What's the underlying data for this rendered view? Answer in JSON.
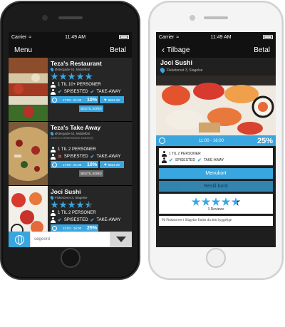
{
  "status": {
    "carrier": "Carrier",
    "time": "11:49 AM"
  },
  "left": {
    "nav": {
      "menu_label": "Menu",
      "pay_label": "Betal"
    },
    "restaurants": [
      {
        "name": "Teza's Restaurant",
        "address": "Østergade 62, Middelfart",
        "notice": "",
        "rating": 5,
        "persons": "1 TIL 10+ PERSONER",
        "dine_in_label": "SPISESTED",
        "dine_in": true,
        "takeaway_label": "TAKE-AWAY",
        "takeaway": true,
        "time": "17:00 - 21:30",
        "discount": "10%",
        "price": "6824.29",
        "book_label": "BESTIL BORD",
        "book_enabled": true
      },
      {
        "name": "Teza's Take Away",
        "address": "Østergade 62, Middelfart",
        "notice": "INGEN VORBEREDNE EMNE(R)",
        "rating": 0,
        "persons": "1 TIL 2 PERSONER",
        "dine_in_label": "SPISESTED",
        "dine_in": false,
        "takeaway_label": "TAKE-AWAY",
        "takeaway": true,
        "time": "17:00 - 21:30",
        "discount": "10%",
        "price": "6824.29",
        "book_label": "BESTIL BORD",
        "book_enabled": false
      },
      {
        "name": "Joci Sushi",
        "address": "Fisketorvet 3, Slagelse",
        "notice": "",
        "rating": 4.5,
        "persons": "1 TIL 2 PERSONER",
        "dine_in_label": "SPISESTED",
        "dine_in": true,
        "takeaway_label": "TAKE-AWAY",
        "takeaway": true,
        "time": "11:00 - 16:00",
        "discount": "25%",
        "price": "",
        "book_label": "",
        "book_enabled": true
      }
    ],
    "search": {
      "placeholder": "søgeord"
    }
  },
  "right": {
    "nav": {
      "back_label": "Tilbage",
      "pay_label": "Betal"
    },
    "name": "Joci Sushi",
    "address": "Fisketorvet 3, Slagelse",
    "time": "11:00 - 16:00",
    "discount": "25%",
    "persons": "1 TIL 2 PERSONER",
    "dine_in_label": "SPISESTED",
    "takeaway_label": "TAKE-AWAY",
    "menu_button": "Menukort",
    "book_button": "Bestil bord",
    "rating": 4.5,
    "reviews": "3 Reviews",
    "description": "På Fisketorvet i Slagelse finder du den hyggelige"
  },
  "colors": {
    "accent": "#3aa6df",
    "dark_bg": "#1e1e1e",
    "cross": "#e23b3b"
  }
}
